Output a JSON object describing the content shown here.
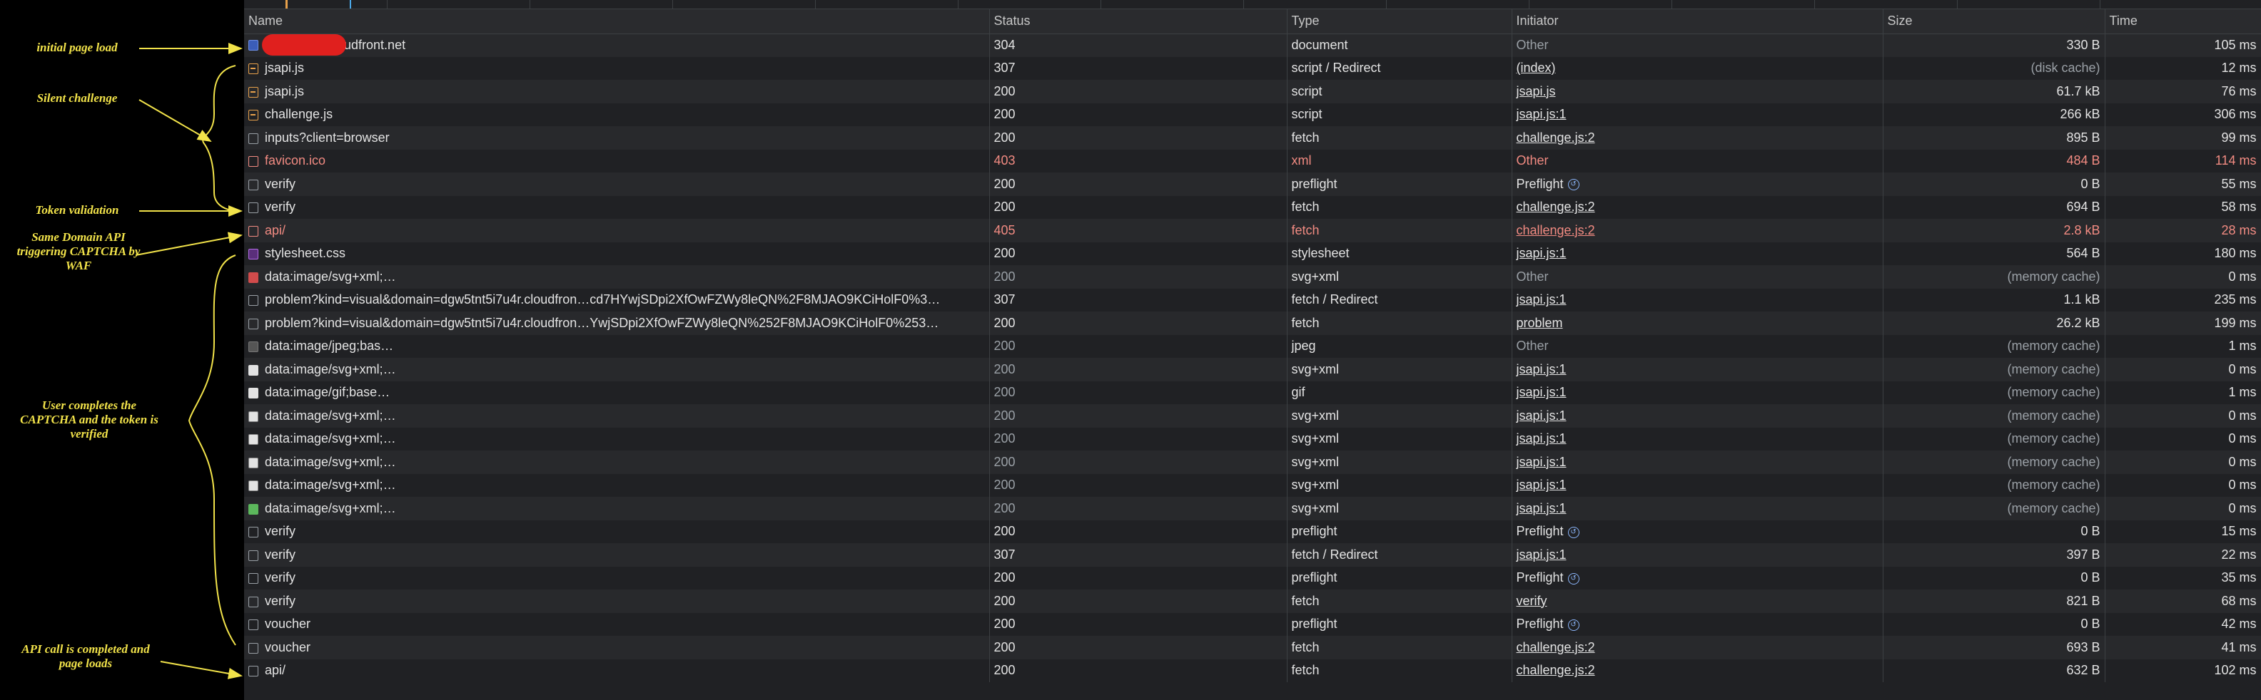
{
  "annotations": [
    {
      "text": "initial page load"
    },
    {
      "text": "Silent challenge"
    },
    {
      "text": "Token validation"
    },
    {
      "text": "Same Domain API triggering CAPTCHA by WAF"
    },
    {
      "text": "User completes the CAPTCHA and the token is verified"
    },
    {
      "text": "API call is completed and page loads"
    }
  ],
  "colors": {
    "annotation": "#f2e34a",
    "error": "#f28b82",
    "background": "#202124"
  },
  "columns": {
    "name": "Name",
    "status": "Status",
    "type": "Type",
    "initiator": "Initiator",
    "size": "Size",
    "time": "Time"
  },
  "rows": [
    {
      "name": "r.cloudfront.net",
      "status": "304",
      "type": "document",
      "initiator": "Other",
      "size": "330 B",
      "time": "105 ms"
    },
    {
      "name": "jsapi.js",
      "status": "307",
      "type": "script / Redirect",
      "initiator": "(index)",
      "size": "(disk cache)",
      "time": "12 ms"
    },
    {
      "name": "jsapi.js",
      "status": "200",
      "type": "script",
      "initiator": "jsapi.js",
      "size": "61.7 kB",
      "time": "76 ms"
    },
    {
      "name": "challenge.js",
      "status": "200",
      "type": "script",
      "initiator": "jsapi.js:1",
      "size": "266 kB",
      "time": "306 ms"
    },
    {
      "name": "inputs?client=browser",
      "status": "200",
      "type": "fetch",
      "initiator": "challenge.js:2",
      "size": "895 B",
      "time": "99 ms"
    },
    {
      "name": "favicon.ico",
      "status": "403",
      "type": "xml",
      "initiator": "Other",
      "size": "484 B",
      "time": "114 ms"
    },
    {
      "name": "verify",
      "status": "200",
      "type": "preflight",
      "initiator": "Preflight",
      "size": "0 B",
      "time": "55 ms"
    },
    {
      "name": "verify",
      "status": "200",
      "type": "fetch",
      "initiator": "challenge.js:2",
      "size": "694 B",
      "time": "58 ms"
    },
    {
      "name": "api/",
      "status": "405",
      "type": "fetch",
      "initiator": "challenge.js:2",
      "size": "2.8 kB",
      "time": "28 ms"
    },
    {
      "name": "stylesheet.css",
      "status": "200",
      "type": "stylesheet",
      "initiator": "jsapi.js:1",
      "size": "564 B",
      "time": "180 ms"
    },
    {
      "name": "data:image/svg+xml;…",
      "status": "200",
      "type": "svg+xml",
      "initiator": "Other",
      "size": "(memory cache)",
      "time": "0 ms"
    },
    {
      "name": "problem?kind=visual&domain=dgw5tnt5i7u4r.cloudfron…cd7HYwjSDpi2XfOwFZWy8leQN%2F8MJAO9KCiHolF0%3…",
      "status": "307",
      "type": "fetch / Redirect",
      "initiator": "jsapi.js:1",
      "size": "1.1 kB",
      "time": "235 ms"
    },
    {
      "name": "problem?kind=visual&domain=dgw5tnt5i7u4r.cloudfron…YwjSDpi2XfOwFZWy8leQN%252F8MJAO9KCiHolF0%253…",
      "status": "200",
      "type": "fetch",
      "initiator": "problem",
      "size": "26.2 kB",
      "time": "199 ms"
    },
    {
      "name": "data:image/jpeg;bas…",
      "status": "200",
      "type": "jpeg",
      "initiator": "Other",
      "size": "(memory cache)",
      "time": "1 ms"
    },
    {
      "name": "data:image/svg+xml;…",
      "status": "200",
      "type": "svg+xml",
      "initiator": "jsapi.js:1",
      "size": "(memory cache)",
      "time": "0 ms"
    },
    {
      "name": "data:image/gif;base…",
      "status": "200",
      "type": "gif",
      "initiator": "jsapi.js:1",
      "size": "(memory cache)",
      "time": "1 ms"
    },
    {
      "name": "data:image/svg+xml;…",
      "status": "200",
      "type": "svg+xml",
      "initiator": "jsapi.js:1",
      "size": "(memory cache)",
      "time": "0 ms"
    },
    {
      "name": "data:image/svg+xml;…",
      "status": "200",
      "type": "svg+xml",
      "initiator": "jsapi.js:1",
      "size": "(memory cache)",
      "time": "0 ms"
    },
    {
      "name": "data:image/svg+xml;…",
      "status": "200",
      "type": "svg+xml",
      "initiator": "jsapi.js:1",
      "size": "(memory cache)",
      "time": "0 ms"
    },
    {
      "name": "data:image/svg+xml;…",
      "status": "200",
      "type": "svg+xml",
      "initiator": "jsapi.js:1",
      "size": "(memory cache)",
      "time": "0 ms"
    },
    {
      "name": "data:image/svg+xml;…",
      "status": "200",
      "type": "svg+xml",
      "initiator": "jsapi.js:1",
      "size": "(memory cache)",
      "time": "0 ms"
    },
    {
      "name": "verify",
      "status": "200",
      "type": "preflight",
      "initiator": "Preflight",
      "size": "0 B",
      "time": "15 ms"
    },
    {
      "name": "verify",
      "status": "307",
      "type": "fetch / Redirect",
      "initiator": "jsapi.js:1",
      "size": "397 B",
      "time": "22 ms"
    },
    {
      "name": "verify",
      "status": "200",
      "type": "preflight",
      "initiator": "Preflight",
      "size": "0 B",
      "time": "35 ms"
    },
    {
      "name": "verify",
      "status": "200",
      "type": "fetch",
      "initiator": "verify",
      "size": "821 B",
      "time": "68 ms"
    },
    {
      "name": "voucher",
      "status": "200",
      "type": "preflight",
      "initiator": "Preflight",
      "size": "0 B",
      "time": "42 ms"
    },
    {
      "name": "voucher",
      "status": "200",
      "type": "fetch",
      "initiator": "challenge.js:2",
      "size": "693 B",
      "time": "41 ms"
    },
    {
      "name": "api/",
      "status": "200",
      "type": "fetch",
      "initiator": "challenge.js:2",
      "size": "632 B",
      "time": "102 ms"
    }
  ]
}
